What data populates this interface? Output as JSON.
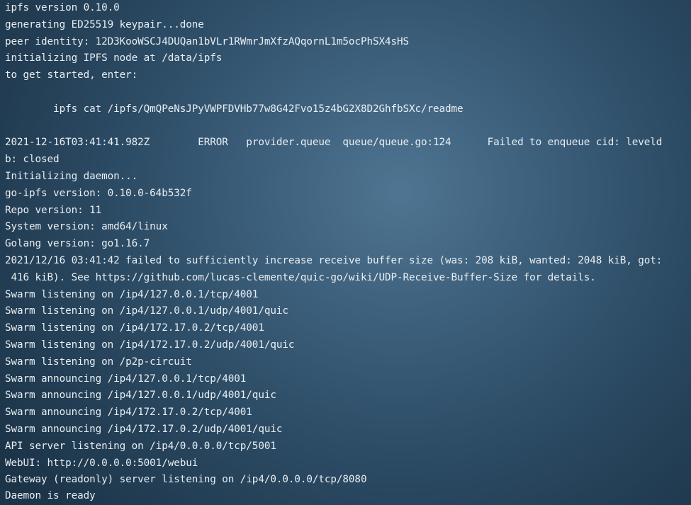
{
  "terminal": {
    "lines": [
      "ipfs version 0.10.0",
      "generating ED25519 keypair...done",
      "peer identity: 12D3KooWSCJ4DUQan1bVLr1RWmrJmXfzAQqornL1m5ocPhSX4sHS",
      "initializing IPFS node at /data/ipfs",
      "to get started, enter:",
      "",
      "        ipfs cat /ipfs/QmQPeNsJPyVWPFDVHb77w8G42Fvo15z4bG2X8D2GhfbSXc/readme",
      "",
      "2021-12-16T03:41:41.982Z        ERROR   provider.queue  queue/queue.go:124      Failed to enqueue cid: leveld",
      "b: closed",
      "Initializing daemon...",
      "go-ipfs version: 0.10.0-64b532f",
      "Repo version: 11",
      "System version: amd64/linux",
      "Golang version: go1.16.7",
      "2021/12/16 03:41:42 failed to sufficiently increase receive buffer size (was: 208 kiB, wanted: 2048 kiB, got:",
      " 416 kiB). See https://github.com/lucas-clemente/quic-go/wiki/UDP-Receive-Buffer-Size for details.",
      "Swarm listening on /ip4/127.0.0.1/tcp/4001",
      "Swarm listening on /ip4/127.0.0.1/udp/4001/quic",
      "Swarm listening on /ip4/172.17.0.2/tcp/4001",
      "Swarm listening on /ip4/172.17.0.2/udp/4001/quic",
      "Swarm listening on /p2p-circuit",
      "Swarm announcing /ip4/127.0.0.1/tcp/4001",
      "Swarm announcing /ip4/127.0.0.1/udp/4001/quic",
      "Swarm announcing /ip4/172.17.0.2/tcp/4001",
      "Swarm announcing /ip4/172.17.0.2/udp/4001/quic",
      "API server listening on /ip4/0.0.0.0/tcp/5001",
      "WebUI: http://0.0.0.0:5001/webui",
      "Gateway (readonly) server listening on /ip4/0.0.0.0/tcp/8080",
      "Daemon is ready"
    ]
  }
}
